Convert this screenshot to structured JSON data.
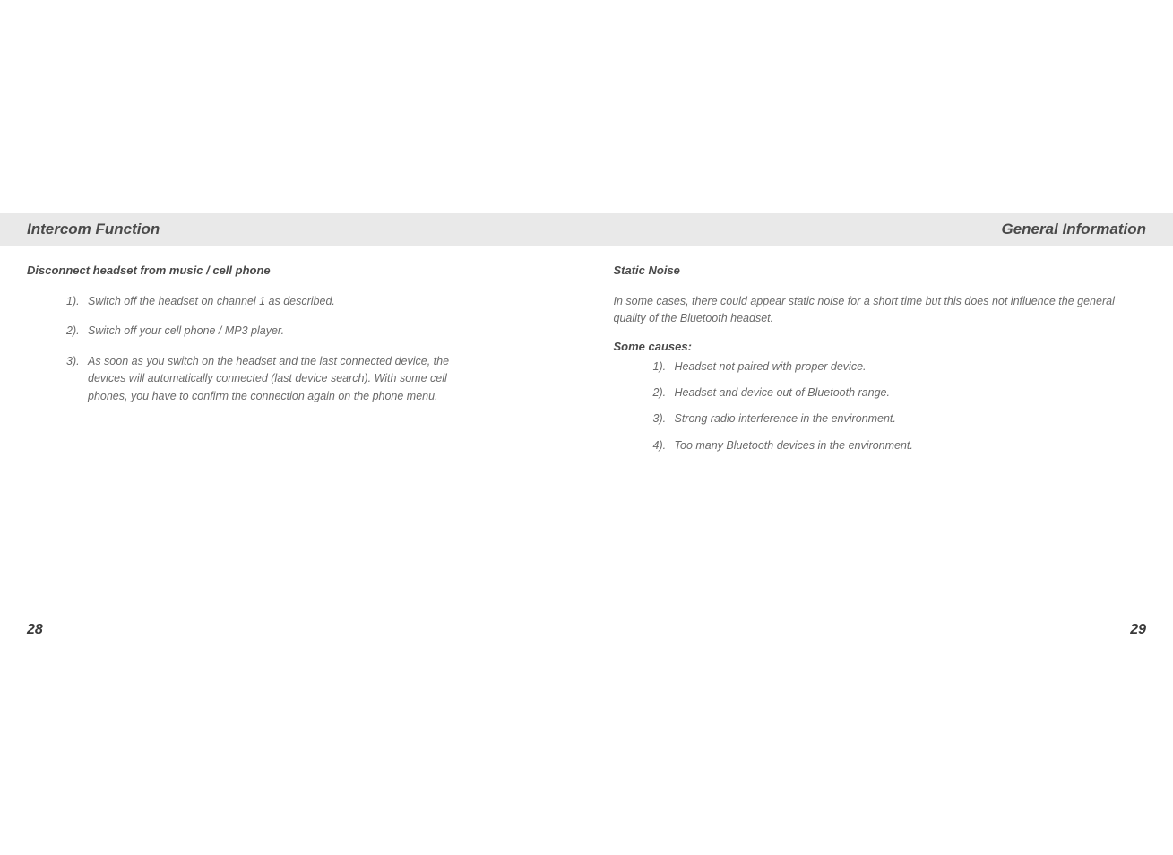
{
  "left": {
    "header": "Intercom Function",
    "subheading": "Disconnect headset from music / cell phone",
    "items": [
      {
        "num": "1).",
        "text": "Switch off the headset on channel 1 as described."
      },
      {
        "num": "2).",
        "text": "Switch off your cell phone / MP3 player."
      },
      {
        "num": "3).",
        "text": "As soon as you switch on the headset and the last connected device, the devices will automatically connected (last device search).  With some cell phones, you have to confirm the connection again on the phone menu."
      }
    ],
    "pageNumber": "28"
  },
  "right": {
    "header": "General Information",
    "subheading": "Static Noise",
    "intro": "In some cases, there could appear static noise for a short time but this does not influence the general quality of the Bluetooth headset.",
    "causesHeading": "Some causes:",
    "causes": [
      {
        "num": "1).",
        "text": "Headset not paired with proper device."
      },
      {
        "num": "2).",
        "text": "Headset and device out of Bluetooth range."
      },
      {
        "num": "3).",
        "text": "Strong radio interference in the environment."
      },
      {
        "num": "4).",
        "text": "Too many Bluetooth devices in the environment."
      }
    ],
    "pageNumber": "29"
  }
}
